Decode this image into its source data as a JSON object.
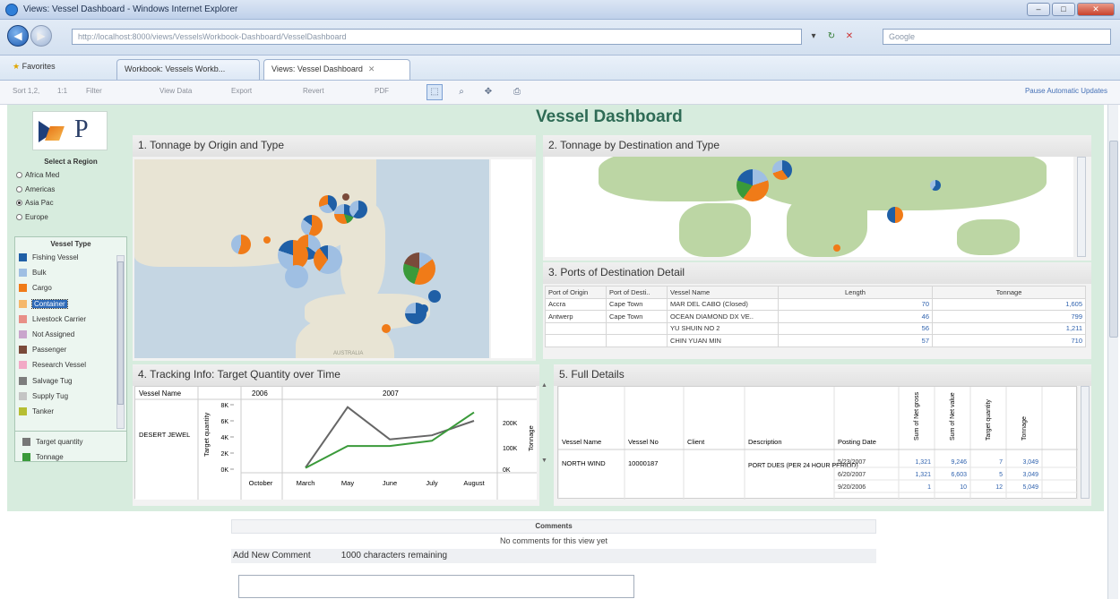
{
  "window": {
    "title": "Views: Vessel Dashboard - Windows Internet Explorer",
    "min": "–",
    "max": "□",
    "close": "✕"
  },
  "address": {
    "url": "http://localhost:8000/views/VesselsWorkbook-Dashboard/VesselDashboard",
    "search_placeholder": "Google"
  },
  "tabs": {
    "favorites": "Favorites",
    "items": [
      "Workbook: Vessels Workb...",
      "Views: Vessel Dashboard"
    ]
  },
  "toolbar": {
    "items": [
      "Sort 1,2,",
      "1:1",
      "Filter",
      "View Data",
      "Export",
      "Revert",
      "PDF"
    ],
    "pause": "Pause Automatic Updates"
  },
  "dashboard": {
    "title": "Vessel Dashboard"
  },
  "region": {
    "title": "Select a Region",
    "options": [
      "Africa Med",
      "Americas",
      "Asia Pac",
      "Europe"
    ],
    "selected": 2
  },
  "vessel_type": {
    "title": "Vessel Type",
    "items": [
      {
        "label": "Fishing Vessel",
        "color": "#1f5fa6"
      },
      {
        "label": "Bulk",
        "color": "#9fbfe3"
      },
      {
        "label": "Cargo",
        "color": "#f07b18"
      },
      {
        "label": "Container",
        "color": "#f5b86a"
      },
      {
        "label": "Livestock Carrier",
        "color": "#e88f87"
      },
      {
        "label": "Not Assigned",
        "color": "#c9a5cc"
      },
      {
        "label": "Passenger",
        "color": "#7a4a3a"
      },
      {
        "label": "Research Vessel",
        "color": "#f2a9c6"
      },
      {
        "label": "Salvage Tug",
        "color": "#7d7d7d"
      },
      {
        "label": "Supply Tug",
        "color": "#c4c4c4"
      },
      {
        "label": "Tanker",
        "color": "#b6be32"
      }
    ],
    "selected": 3,
    "measures": [
      {
        "label": "Target quantity",
        "color": "#777777"
      },
      {
        "label": "Tonnage",
        "color": "#3a9a3a"
      }
    ]
  },
  "panel1": {
    "title": "1. Tonnage by Origin and Type",
    "map_label": "AUSTRALIA"
  },
  "panel2": {
    "title": "2. Tonnage by Destination and Type"
  },
  "panel3": {
    "title": "3. Ports of Destination Detail",
    "headers": [
      "Port of Origin",
      "Port of Desti..",
      "Vessel Name",
      "Length",
      "Tonnage"
    ],
    "rows": [
      [
        "Accra",
        "Cape Town",
        "MAR DEL CABO (Closed)",
        "70",
        "1,605"
      ],
      [
        "Antwerp",
        "Cape Town",
        "OCEAN DIAMOND DX VE..",
        "46",
        "799"
      ],
      [
        "",
        "",
        "YU SHUIN NO 2",
        "56",
        "1,211"
      ],
      [
        "",
        "",
        "CHIN YUAN MIN",
        "57",
        "710"
      ]
    ]
  },
  "panel4": {
    "title": "4. Tracking Info: Target Quantity over Time",
    "col_vessel": "Vessel Name",
    "year_2006": "2006",
    "year_2007": "2007",
    "vessel": "DESERT JEWEL",
    "y_label": "Target quantity",
    "y2_label": "Tonnage",
    "y_ticks": [
      "8K",
      "6K",
      "4K",
      "2K",
      "0K"
    ],
    "y2_ticks": [
      "200K",
      "100K",
      "0K"
    ],
    "months": [
      "October",
      "March",
      "May",
      "June",
      "July",
      "August"
    ]
  },
  "chart_data": {
    "type": "line",
    "categories": [
      "March",
      "May",
      "June",
      "July",
      "August"
    ],
    "series": [
      {
        "name": "Target quantity",
        "color": "#666666",
        "values": [
          200,
          7700,
          3700,
          4200,
          6000
        ]
      },
      {
        "name": "Tonnage",
        "color": "#3a9a3a",
        "values": [
          5000,
          90000,
          90000,
          110000,
          220000
        ]
      }
    ],
    "ylabel": "Target quantity",
    "y2label": "Tonnage",
    "ylim": [
      0,
      8000
    ],
    "y2lim": [
      0,
      250000
    ]
  },
  "panel5": {
    "title": "5. Full Details",
    "headers": [
      "Vessel Name",
      "Vessel No",
      "Client",
      "Description",
      "Posting Date",
      "Sum of Net gross",
      "Sum of Net value",
      "Target quantity",
      "Tonnage"
    ],
    "vessel": "NORTH WIND",
    "vessel_no": "10000187",
    "description": "PORT DUES (PER 24 HOUR PERIOD)",
    "rows": [
      [
        "5/23/2007",
        "1,321",
        "9,246",
        "7",
        "3,049"
      ],
      [
        "6/20/2007",
        "1,321",
        "6,603",
        "5",
        "3,049"
      ],
      [
        "9/20/2006",
        "1",
        "10",
        "12",
        "5,049"
      ]
    ]
  },
  "comments": {
    "title": "Comments",
    "none": "No comments for this view yet",
    "add": "Add New Comment",
    "remaining": "1000 characters remaining"
  }
}
